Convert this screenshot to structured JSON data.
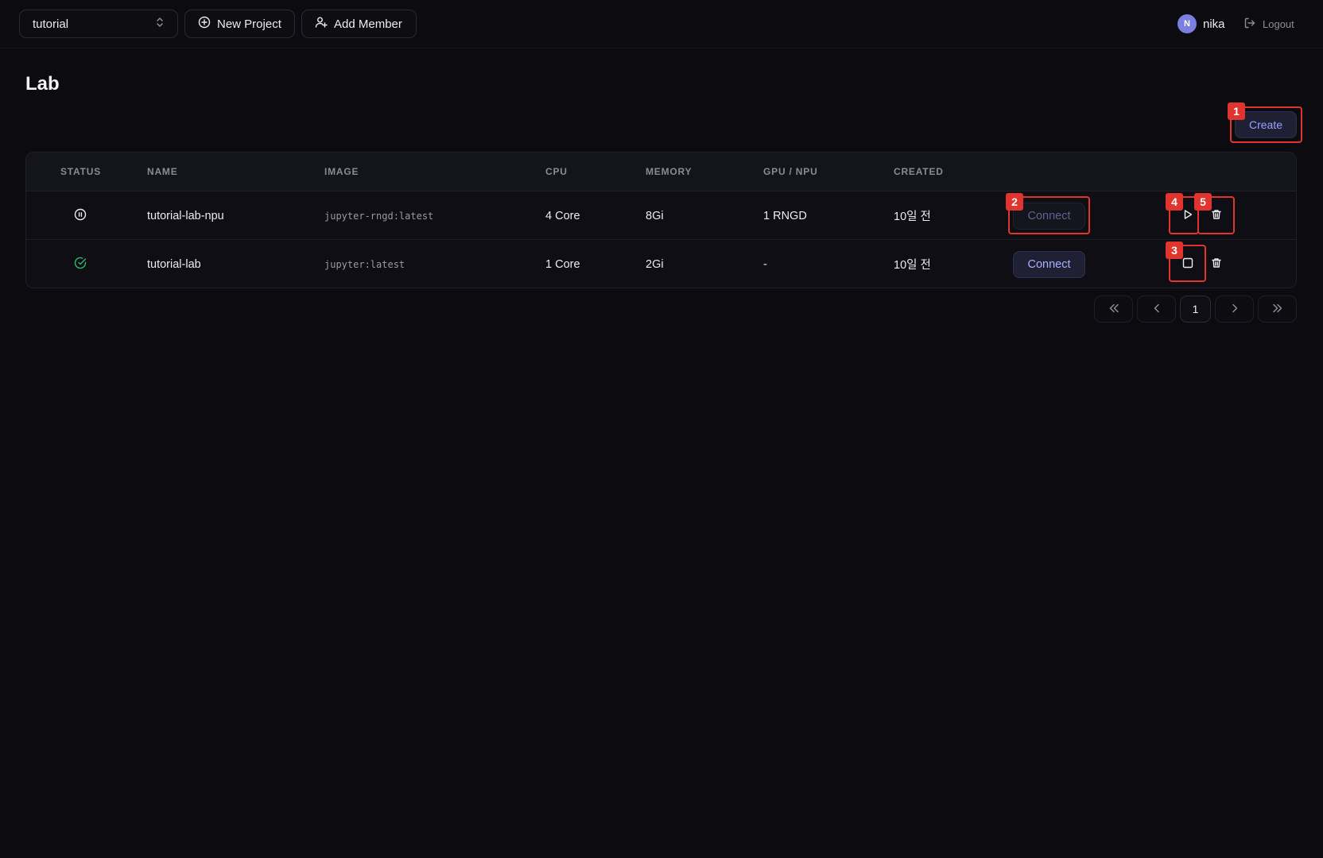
{
  "header": {
    "project_select": {
      "value": "tutorial"
    },
    "new_project_label": "New Project",
    "add_member_label": "Add Member",
    "user": {
      "initial": "N",
      "name": "nika"
    },
    "logout_label": "Logout"
  },
  "page": {
    "title": "Lab",
    "create_label": "Create"
  },
  "table": {
    "columns": [
      "STATUS",
      "NAME",
      "IMAGE",
      "CPU",
      "MEMORY",
      "GPU / NPU",
      "CREATED"
    ],
    "rows": [
      {
        "status": "paused",
        "status_icon": "pause-circle-icon",
        "name": "tutorial-lab-npu",
        "image": "jupyter-rngd:latest",
        "cpu": "4 Core",
        "memory": "8Gi",
        "gpu": "1 RNGD",
        "created": "10일 전",
        "connect_label": "Connect",
        "connect_enabled": false
      },
      {
        "status": "running",
        "status_icon": "check-circle-icon",
        "name": "tutorial-lab",
        "image": "jupyter:latest",
        "cpu": "1 Core",
        "memory": "2Gi",
        "gpu": "-",
        "created": "10일 전",
        "connect_label": "Connect",
        "connect_enabled": true
      }
    ]
  },
  "pagination": {
    "current_page": "1"
  },
  "annotations": [
    "1",
    "2",
    "3",
    "4",
    "5"
  ],
  "colors": {
    "background": "#0b0b10",
    "accent": "#9aa0ff",
    "running": "#2fb86a",
    "annotation": "#e0342e"
  }
}
